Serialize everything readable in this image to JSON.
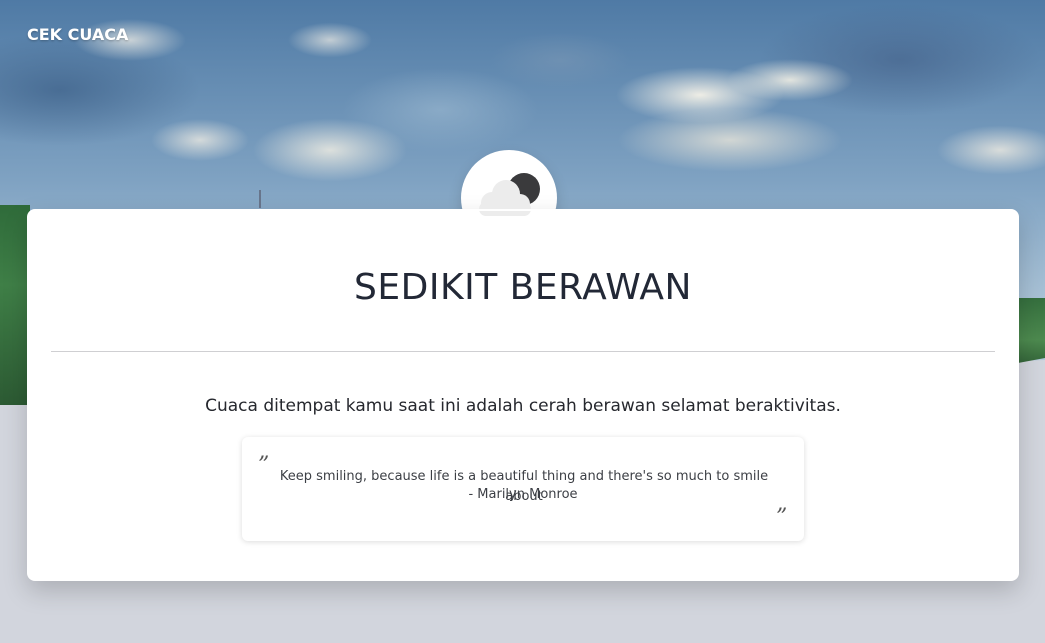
{
  "header": {
    "brand": "CEK CUACA"
  },
  "weather": {
    "icon": "partly-cloudy-night-icon",
    "condition_title": "SEDIKIT BERAWAN",
    "description": "Cuaca ditempat kamu saat ini adalah cerah berawan selamat beraktivitas."
  },
  "quote": {
    "open_mark": "”",
    "close_mark": "”",
    "text": "Keep smiling, because life is a beautiful thing and there's so much to smile about",
    "author": "- Marilyn Monroe"
  },
  "colors": {
    "page_background": "#d2d5dd",
    "card_background": "#ffffff",
    "title_color": "#222836",
    "brand_text": "#ffffff"
  }
}
